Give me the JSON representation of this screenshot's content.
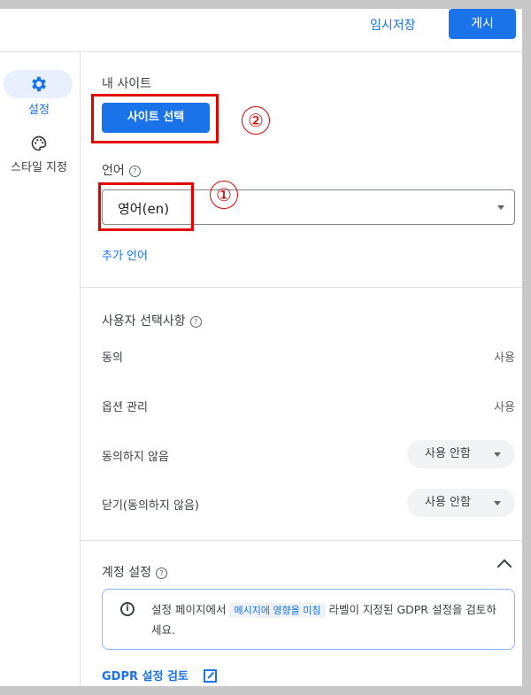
{
  "header": {
    "draft_label": "임시저장",
    "publish_label": "게시"
  },
  "rail": {
    "items": [
      {
        "label": "설정",
        "icon": "gear-icon",
        "active": true
      },
      {
        "label": "스타일 지정",
        "icon": "palette-icon",
        "active": false
      }
    ]
  },
  "site": {
    "title": "내 사이트",
    "button_label": "사이트 선택"
  },
  "language": {
    "title": "언어",
    "selected": "영어(en)",
    "more_link": "추가 언어"
  },
  "annotations": {
    "step1": "①",
    "step2": "②",
    "highlight_color": "#e50000"
  },
  "user_choices": {
    "title": "사용자 선택사항",
    "rows": [
      {
        "label": "동의",
        "value": "사용"
      },
      {
        "label": "옵션 관리",
        "value": "사용"
      },
      {
        "label": "동의하지 않음",
        "value": "사용 안함"
      },
      {
        "label": "닫기(동의하지 않음)",
        "value": "사용 안함"
      }
    ]
  },
  "account": {
    "title": "계정 설정",
    "notice_before": "설정 페이지에서 ",
    "notice_tag": "메시지에 영향을 미침",
    "notice_after": " 라벨이 지정된 GDPR 설정을 검토하세요.",
    "review_link": "GDPR 설정 검토"
  },
  "colors": {
    "accent": "#1a73e8",
    "active_pill": "#e8f0fe"
  }
}
